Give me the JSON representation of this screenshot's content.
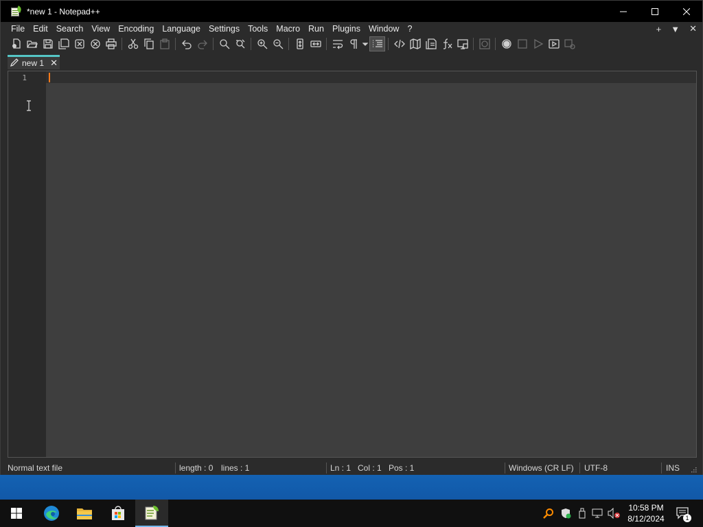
{
  "window": {
    "title": "*new 1 - Notepad++"
  },
  "menu": {
    "items": [
      "File",
      "Edit",
      "Search",
      "View",
      "Encoding",
      "Language",
      "Settings",
      "Tools",
      "Macro",
      "Run",
      "Plugins",
      "Window",
      "?"
    ],
    "right_items": [
      "+",
      "▼",
      "✕"
    ]
  },
  "toolbar": {
    "buttons": [
      "new-file",
      "open-file",
      "save",
      "save-all",
      "close",
      "close-all",
      "print",
      "cut",
      "copy",
      "paste",
      "undo",
      "redo",
      "find",
      "replace",
      "zoom-in",
      "zoom-out",
      "sync-vertical",
      "sync-horizontal",
      "word-wrap",
      "show-all-characters",
      "indent-guide",
      "xml-tag",
      "document-map",
      "document-list",
      "function-list",
      "folder-as-workspace",
      "monitoring",
      "record-macro",
      "stop-recording",
      "playback-macro",
      "run-macro-multiple",
      "save-macro"
    ]
  },
  "tab": {
    "label": "new 1",
    "close": "✕"
  },
  "editor": {
    "line_numbers": [
      "1"
    ],
    "content": ""
  },
  "statusbar": {
    "file_type": "Normal text file",
    "length": "length : 0",
    "lines": "lines : 1",
    "ln": "Ln : 1",
    "col": "Col : 1",
    "pos": "Pos : 1",
    "eol": "Windows (CR LF)",
    "encoding": "UTF-8",
    "mode": "INS"
  },
  "taskbar": {
    "apps": [
      "start",
      "edge",
      "file-explorer",
      "microsoft-store",
      "notepad-plus-plus"
    ],
    "active_app": "notepad-plus-plus",
    "time": "10:58 PM",
    "date": "8/12/2024",
    "notification_count": "1"
  },
  "colors": {
    "accent_tab": "#55c6c6",
    "caret": "#ff7a1a",
    "taskbar_active": "#76b9ed"
  }
}
